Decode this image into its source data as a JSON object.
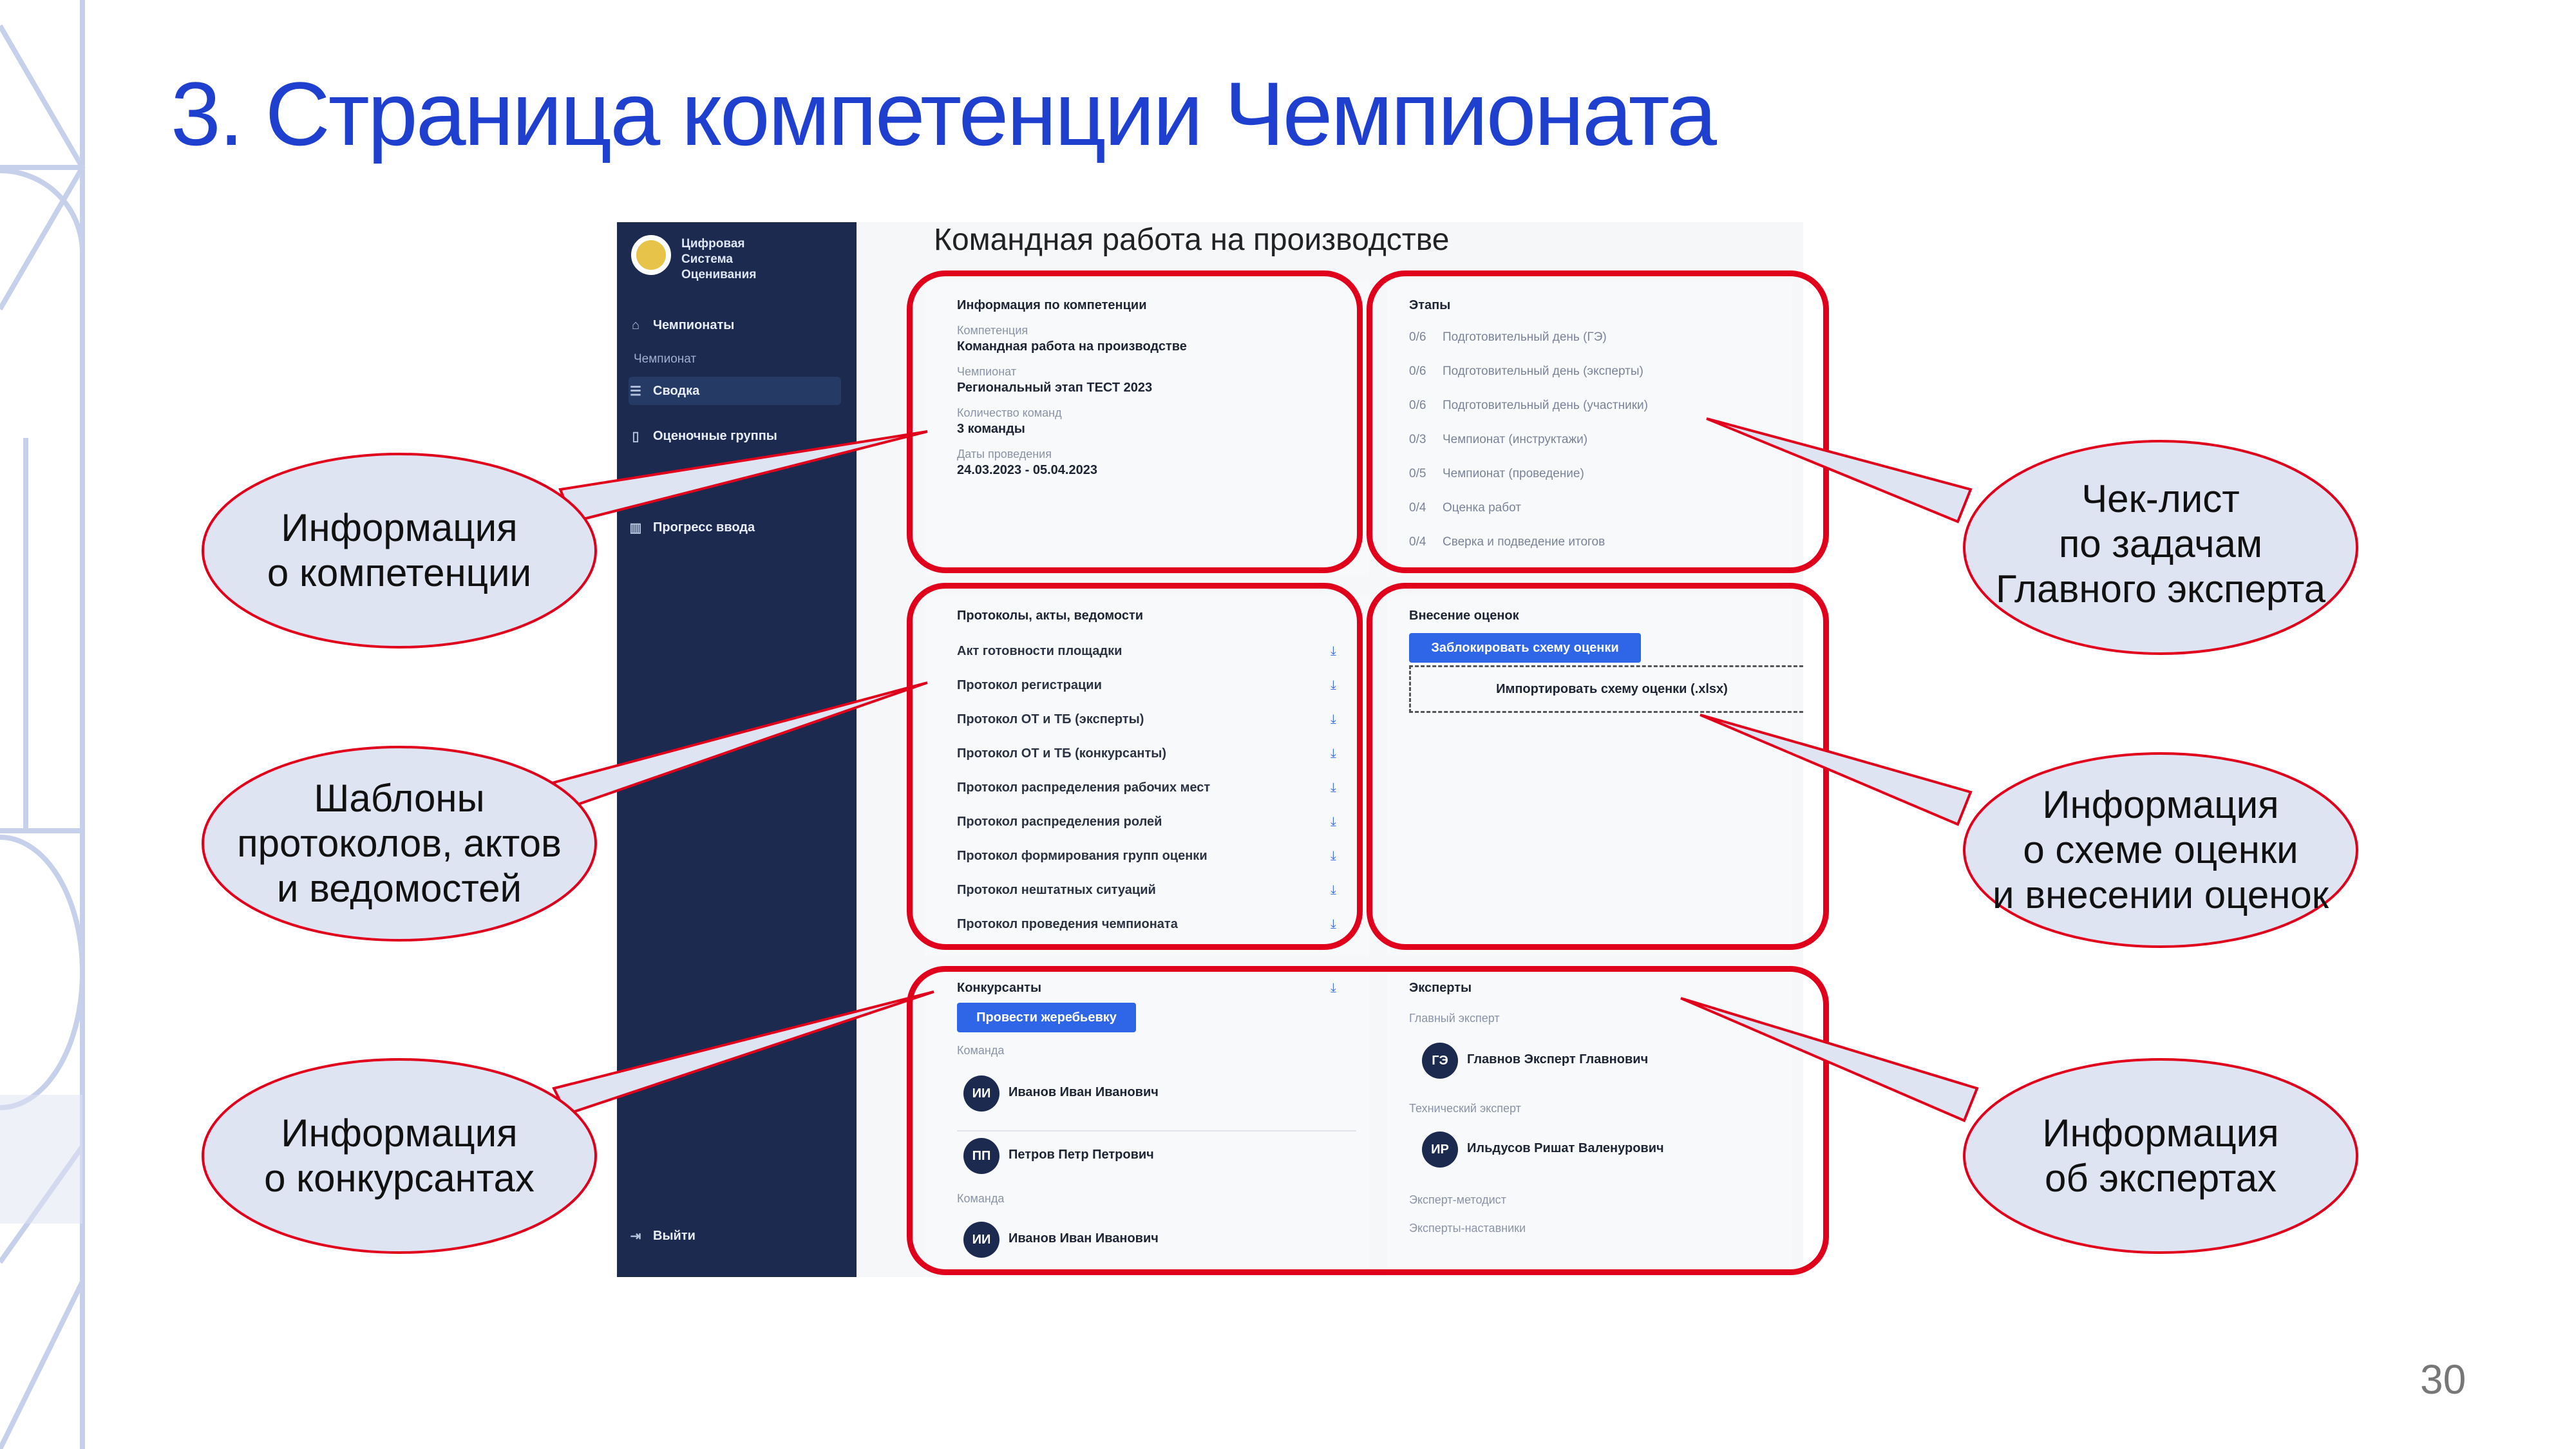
{
  "slide": {
    "title": "3. Страница компетенции Чемпионата",
    "page_number": "30"
  },
  "app": {
    "logo_text": "Цифровая\nСистема\nОценивания",
    "sidebar": {
      "items": [
        {
          "label": "Чемпионаты",
          "icon": "home-icon"
        },
        {
          "label": "Сводка",
          "icon": "list-icon",
          "active": true
        },
        {
          "label": "Оценочные группы",
          "icon": "document-icon"
        },
        {
          "label": "Прогресс ввода",
          "icon": "bar-chart-icon"
        }
      ],
      "section_label": "Чемпионат",
      "logout_label": "Выйти"
    },
    "page_title": "Командная работа на производстве",
    "competence_info": {
      "title": "Информация по компетенции",
      "fields": [
        {
          "label": "Компетенция",
          "value": "Командная работа на производстве"
        },
        {
          "label": "Чемпионат",
          "value": "Региональный этап ТЕСТ 2023"
        },
        {
          "label": "Количество команд",
          "value": "3 команды"
        },
        {
          "label": "Даты проведения",
          "value": "24.03.2023 - 05.04.2023"
        }
      ]
    },
    "stages": {
      "title": "Этапы",
      "rows": [
        {
          "count": "0/6",
          "name": "Подготовительный день (ГЭ)"
        },
        {
          "count": "0/6",
          "name": "Подготовительный день (эксперты)"
        },
        {
          "count": "0/6",
          "name": "Подготовительный день (участники)"
        },
        {
          "count": "0/3",
          "name": "Чемпионат (инструктажи)"
        },
        {
          "count": "0/5",
          "name": "Чемпионат (проведение)"
        },
        {
          "count": "0/4",
          "name": "Оценка работ"
        },
        {
          "count": "0/4",
          "name": "Сверка и подведение итогов"
        }
      ]
    },
    "protocols": {
      "title": "Протоколы, акты, ведомости",
      "rows": [
        "Акт готовности площадки",
        "Протокол регистрации",
        "Протокол ОТ и ТБ (эксперты)",
        "Протокол ОТ и ТБ (конкурсанты)",
        "Протокол распределения рабочих мест",
        "Протокол распределения ролей",
        "Протокол формирования групп оценки",
        "Протокол нештатных ситуаций",
        "Протокол проведения чемпионата"
      ]
    },
    "scores": {
      "title": "Внесение оценок",
      "lock_button": "Заблокировать схему оценки",
      "import_button": "Импортировать схему оценки (.xlsx)"
    },
    "contestants": {
      "title": "Конкурсанты",
      "draw_button": "Провести жеребьевку",
      "team_label": "Команда",
      "people": [
        {
          "initials": "ИИ",
          "name": "Иванов Иван Иванович"
        },
        {
          "initials": "ПП",
          "name": "Петров Петр Петрович"
        },
        {
          "initials": "ИИ",
          "name": "Иванов Иван Иванович"
        }
      ]
    },
    "experts": {
      "title": "Эксперты",
      "chief_label": "Главный эксперт",
      "chief": {
        "initials": "ГЭ",
        "name": "Главнов Эксперт Главнович"
      },
      "tech_label": "Технический эксперт",
      "tech": {
        "initials": "ИР",
        "name": "Ильдусов Ришат Валенурович"
      },
      "methodist_label": "Эксперт-методист",
      "mentors_label": "Эксперты-наставники"
    }
  },
  "callouts": {
    "competence": "Информация\nо компетенции",
    "checklist": "Чек-лист\nпо задачам\nГлавного эксперта",
    "templates": "Шаблоны\nпротоколов, актов\nи ведомостей",
    "scoring": "Информация\nо схеме оценки\nи внесении оценок",
    "contestants": "Информация\nо конкурсантах",
    "experts": "Информация\nоб экспертах"
  },
  "colors": {
    "title_blue": "#1f3fcf",
    "frame_red": "#e0001b",
    "callout_fill": "#dfe4f3",
    "sidebar_bg": "#1b2a4e",
    "button_blue": "#2f66e8"
  }
}
